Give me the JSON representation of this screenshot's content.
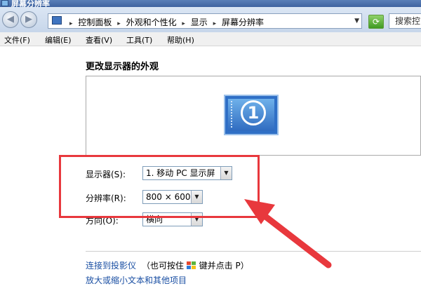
{
  "window": {
    "title": "屏幕分辨率"
  },
  "address": {
    "crumbs": [
      "控制面板",
      "外观和个性化",
      "显示",
      "屏幕分辨率"
    ],
    "search_placeholder": "搜索控"
  },
  "menu": [
    "文件(F)",
    "编辑(E)",
    "查看(V)",
    "工具(T)",
    "帮助(H)"
  ],
  "content": {
    "heading": "更改显示器的外观",
    "monitor_number": "1",
    "display_label": "显示器(S):",
    "display_value": "1. 移动 PC 显示屏",
    "resolution_label": "分辨率(R):",
    "resolution_value": "800 × 600",
    "orientation_label": "方向(O):",
    "orientation_value": "横向",
    "link_projector": "连接到投影仪",
    "hint_prefix": "（也可按住",
    "hint_suffix": "键并点击 P）",
    "link_text_size": "放大或缩小文本和其他项目"
  },
  "annotation": {
    "color": "#e8383d"
  }
}
